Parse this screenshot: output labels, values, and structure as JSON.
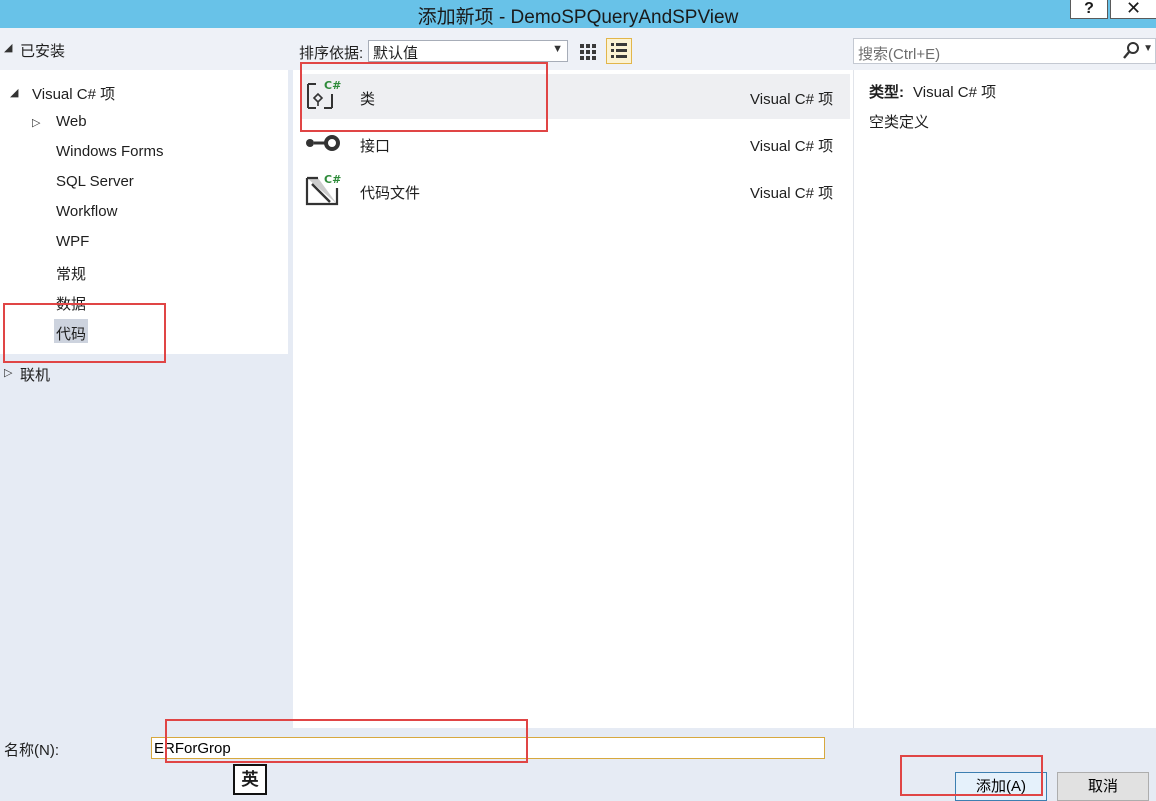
{
  "window": {
    "title": "添加新项 - DemoSPQueryAndSPView",
    "help_label": "?",
    "close_label": "✕"
  },
  "left_panel": {
    "installed_label": "已安装",
    "tree": [
      {
        "label": "Visual C# 项"
      },
      {
        "label": "Web"
      },
      {
        "label": "Windows Forms"
      },
      {
        "label": "SQL Server"
      },
      {
        "label": "Workflow"
      },
      {
        "label": "WPF"
      },
      {
        "label": "常规"
      },
      {
        "label": "数据"
      },
      {
        "label": "代码",
        "selected": true
      }
    ],
    "online_label": "联机"
  },
  "toolbar": {
    "sort_label": "排序依据:",
    "sort_value": "默认值",
    "view_mode": "list"
  },
  "search": {
    "placeholder": "搜索(Ctrl+E)"
  },
  "items": [
    {
      "name": "类",
      "type": "Visual C# 项",
      "icon": "class-icon",
      "selected": true
    },
    {
      "name": "接口",
      "type": "Visual C# 项",
      "icon": "interface-icon"
    },
    {
      "name": "代码文件",
      "type": "Visual C# 项",
      "icon": "code-file-icon"
    }
  ],
  "detail": {
    "type_label": "类型:",
    "type_value": "Visual C# 项",
    "description": "空类定义"
  },
  "bottom": {
    "name_label": "名称(N):",
    "name_value": "ERForGrop",
    "ime_label": "英",
    "add_label": "添加(A)",
    "cancel_label": "取消"
  },
  "colors": {
    "title_bar": "#68c2e8",
    "annotation": "#e04545",
    "csharp_badge": "#2e8b3a"
  }
}
